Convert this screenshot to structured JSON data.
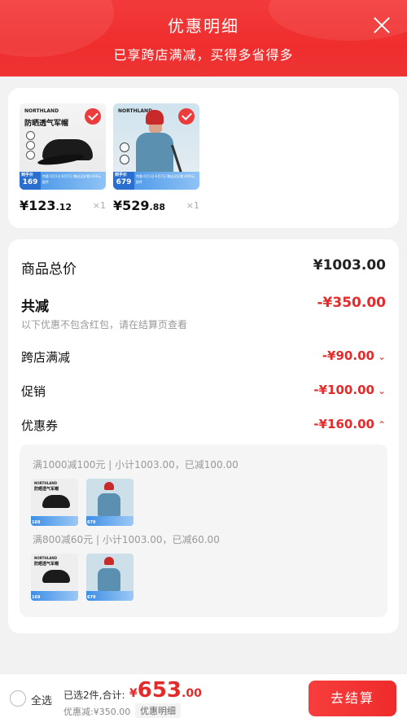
{
  "header": {
    "title": "优惠明细",
    "subtitle": "已享跨店满减，买得多省得多"
  },
  "products": [
    {
      "brand": "NORTHLAND",
      "name_on_image": "防晒透气军帽",
      "band_price": "169",
      "band_label": "到手价",
      "band_text": "特惠 6月1日-6月7日  赠送买好看1000元配件",
      "price_int": "¥123",
      "price_dec": ".12",
      "qty": "×1",
      "selected": true
    },
    {
      "brand": "NORTHLAND",
      "band_price": "679",
      "band_label": "到手价",
      "band_text": "特惠 6月1日-6月7日  赠送买好看1000元配件",
      "price_int": "¥529",
      "price_dec": ".88",
      "qty": "×1",
      "selected": true
    }
  ],
  "summary": {
    "goods_total_label": "商品总价",
    "goods_total_value": "¥1003.00",
    "total_discount_label": "共减",
    "total_discount_value": "-¥350.00",
    "note": "以下优惠不包含红包，请在结算页查看",
    "rows": [
      {
        "label": "跨店满减",
        "value": "-¥90.00",
        "chevron": "chevron-down-icon"
      },
      {
        "label": "促销",
        "value": "-¥100.00",
        "chevron": "chevron-down-icon"
      },
      {
        "label": "优惠券",
        "value": "-¥160.00",
        "chevron": "chevron-up-icon"
      }
    ],
    "coupons": [
      {
        "title": "满1000减100元 | 小计1003.00，已减100.00"
      },
      {
        "title": "满800减60元 | 小计1003.00，已减60.00"
      }
    ],
    "mini_band_prices": [
      "169",
      "679"
    ]
  },
  "footer": {
    "select_all": "全选",
    "selected_count": "已选2件,合计:",
    "total_yen": "¥",
    "total_int": "653",
    "total_dec": ".00",
    "discount_line": "优惠减:¥350.00",
    "discount_link": "优惠明细",
    "checkout_label": "去结算"
  },
  "colors": {
    "accent_red": "#e42b2b",
    "header_red": "#ef2d2d",
    "background": "#f2f2f2"
  }
}
